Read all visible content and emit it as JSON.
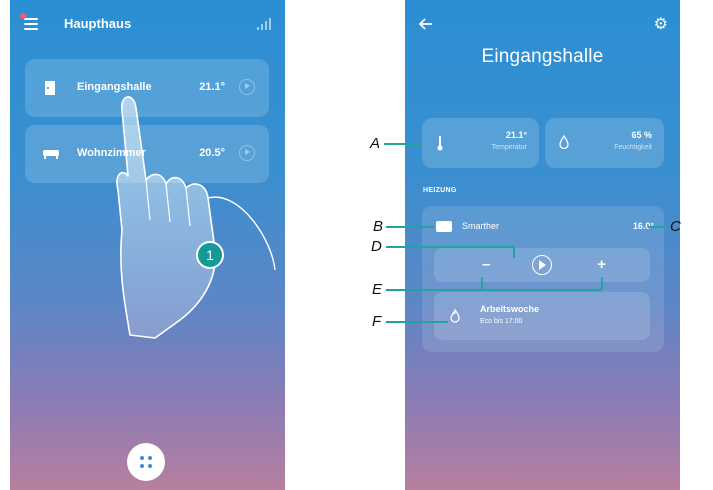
{
  "left_screen": {
    "header": {
      "title": "Haupthaus"
    },
    "rooms": [
      {
        "name": "Eingangshalle",
        "temp": "21.1°"
      },
      {
        "name": "Wohnzimmer",
        "temp": "20.5°"
      }
    ],
    "step_badge": "1"
  },
  "right_screen": {
    "title": "Eingangshalle",
    "sensors": [
      {
        "value": "21.1°",
        "label": "Temperatur",
        "icon": "thermometer-icon"
      },
      {
        "value": "65 %",
        "label": "Feuchtigkeit",
        "icon": "droplet-icon"
      }
    ],
    "section_label": "HEIZUNG",
    "thermostat": {
      "name": "Smarther",
      "temp": "16.0°"
    },
    "controls": {
      "minus": "–",
      "plus": "+"
    },
    "program": {
      "name": "Arbeitswoche",
      "subtitle": "Eco bis 17:00"
    }
  },
  "callouts": {
    "A": "A",
    "B": "B",
    "C": "C",
    "D": "D",
    "E": "E",
    "F": "F"
  },
  "colors": {
    "accent": "#139a96",
    "callout_line": "#23a39d",
    "alert_dot": "#ff5a6e"
  }
}
